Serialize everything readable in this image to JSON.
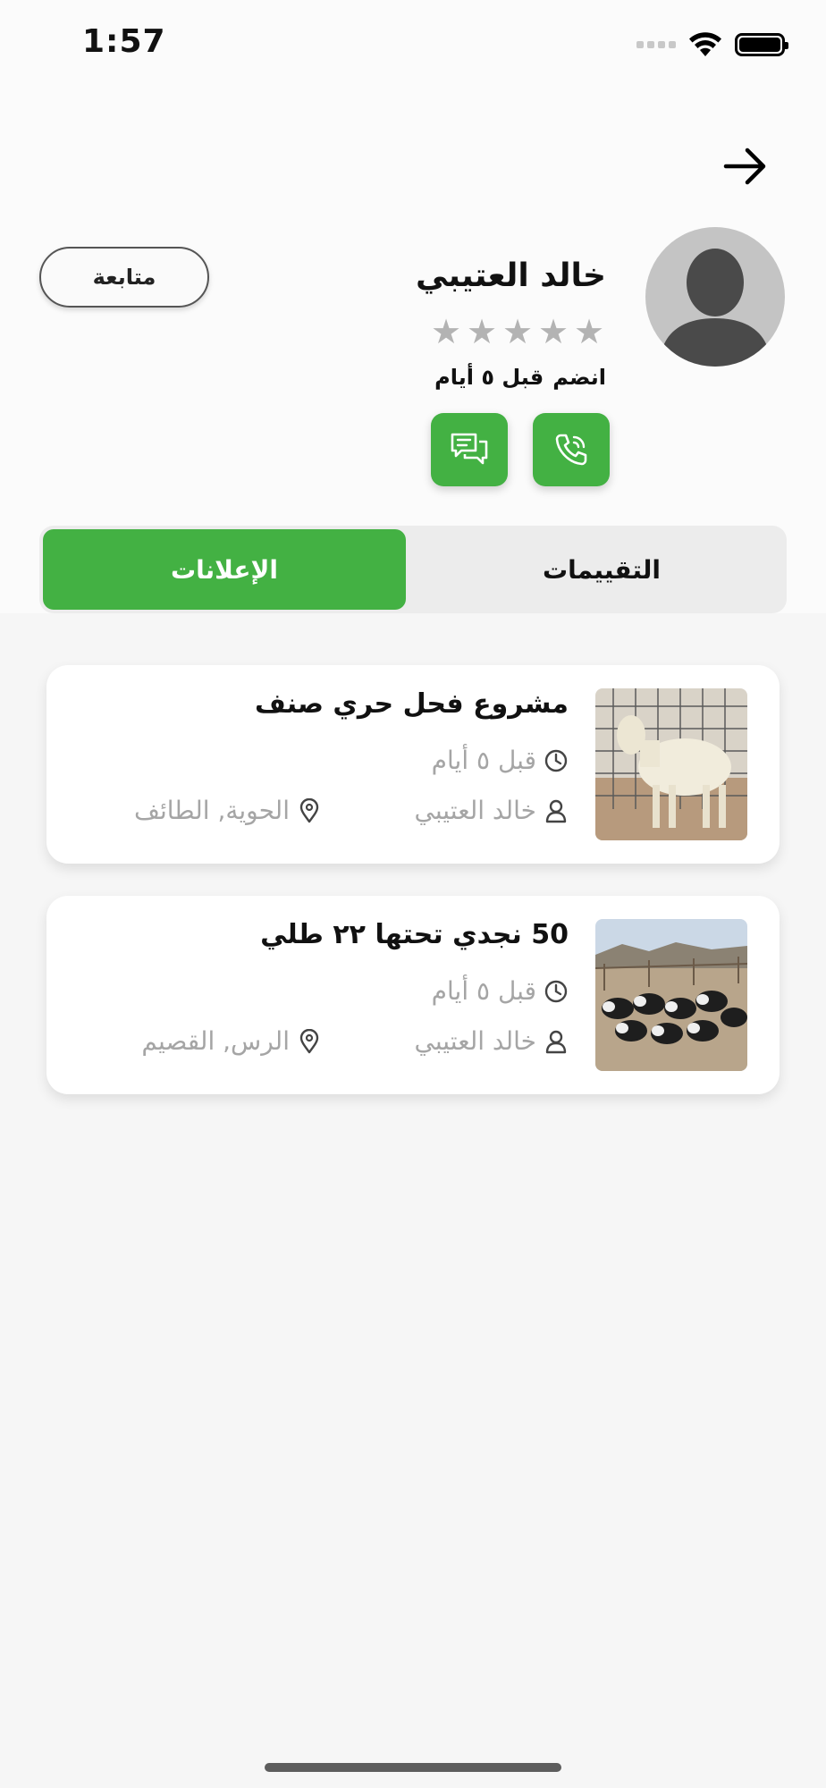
{
  "status_bar": {
    "time": "1:57"
  },
  "profile": {
    "name": "خالد العتيبي",
    "rating": 0,
    "rating_max": 5,
    "joined_label": "انضم",
    "joined_value": "قبل ٥ أيام",
    "follow_label": "متابعة"
  },
  "tabs": {
    "ads": "الإعلانات",
    "reviews": "التقييمات",
    "active": "ads"
  },
  "listings": [
    {
      "title": "مشروع فحل حري صنف",
      "time": "قبل ٥ أيام",
      "owner": "خالد العتيبي",
      "location": "الحوية, الطائف"
    },
    {
      "title": "50 نجدي تحتها ٢٢ طلي",
      "time": "قبل ٥ أيام",
      "owner": "خالد العتيبي",
      "location": "الرس, القصيم"
    }
  ],
  "colors": {
    "accent": "#43b143",
    "star_inactive": "#b3b3b3",
    "meta_text": "#a5a5a5"
  },
  "icons": {
    "back": "arrow-right-icon",
    "call": "phone-icon",
    "chat": "chat-bubbles-icon",
    "time": "clock-icon",
    "owner": "user-icon",
    "location": "map-pin-icon"
  }
}
